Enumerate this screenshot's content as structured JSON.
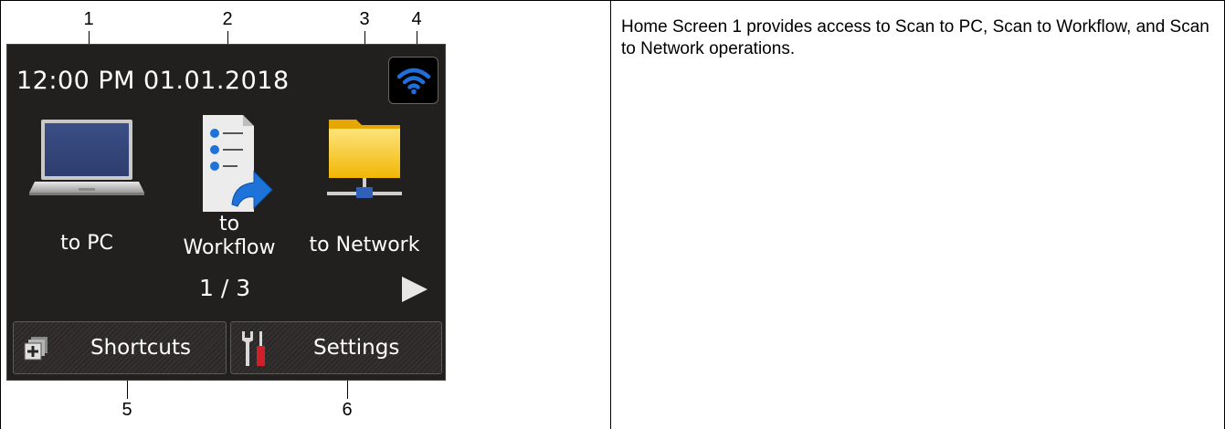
{
  "screen": {
    "clock": "12:00 PM 01.01.2018",
    "apps": [
      {
        "label_lines": [
          "to PC"
        ]
      },
      {
        "label_lines": [
          "to",
          "Workflow"
        ]
      },
      {
        "label_lines": [
          "to Network"
        ]
      }
    ],
    "pager": "1 / 3",
    "buttons": {
      "shortcuts_label": "Shortcuts",
      "settings_label": "Settings"
    },
    "icons": {
      "wifi": "wifi-icon",
      "pc": "laptop-icon",
      "workflow": "workflow-checklist-icon",
      "network": "network-folder-icon",
      "next": "next-arrow-icon",
      "shortcuts": "shortcuts-plus-icon",
      "settings": "tools-icon"
    },
    "colors": {
      "screen_bg": "#221f1f",
      "wifi_blue": "#1e6fd9",
      "folder_yellow": "#f6c90e",
      "tool_red": "#d2202a"
    }
  },
  "callouts": {
    "top": [
      "1",
      "2",
      "3",
      "4"
    ],
    "bottom": [
      "5",
      "6"
    ]
  },
  "description": "Home Screen 1 provides access to Scan to PC, Scan to Workflow, and Scan to Network operations."
}
